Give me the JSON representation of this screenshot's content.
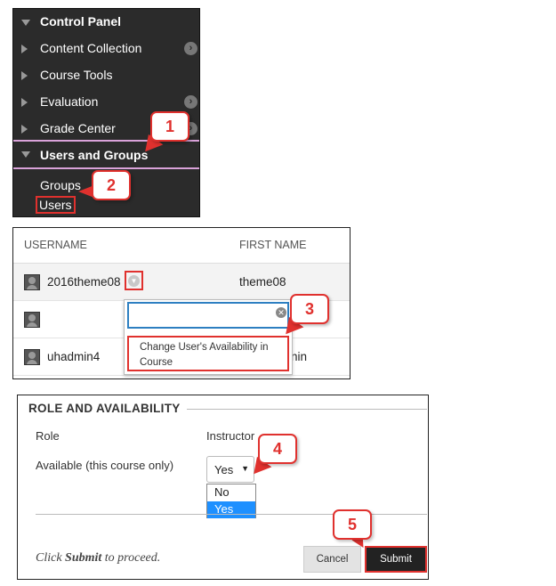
{
  "control_panel": {
    "title": "Control Panel",
    "items": [
      {
        "label": "Content Collection"
      },
      {
        "label": "Course Tools"
      },
      {
        "label": "Evaluation"
      },
      {
        "label": "Grade Center"
      },
      {
        "label": "Users and Groups"
      }
    ],
    "sub_items": [
      {
        "label": "Groups"
      },
      {
        "label": "Users"
      }
    ]
  },
  "users_list": {
    "columns": [
      "USERNAME",
      "FIRST NAME"
    ],
    "rows": [
      {
        "username": "2016theme08",
        "first_name": "theme08"
      },
      {
        "username": "",
        "first_name": ""
      },
      {
        "username": "uhadmin4",
        "first_name": "nin"
      }
    ],
    "dropdown": {
      "search_value": "",
      "option": "Change User's Availability in Course"
    }
  },
  "role_availability": {
    "title": "ROLE AND AVAILABILITY",
    "role_label": "Role",
    "role_value": "Instructor",
    "available_label": "Available (this course only)",
    "available_selected": "Yes",
    "available_options": [
      "No",
      "Yes"
    ],
    "hint_prefix": "Click ",
    "hint_bold": "Submit",
    "hint_suffix": " to proceed.",
    "cancel_label": "Cancel",
    "submit_label": "Submit"
  },
  "callouts": [
    "1",
    "2",
    "3",
    "4",
    "5"
  ],
  "colors": {
    "callout": "#e0312e",
    "panel_bg": "#2b2b2b",
    "highlight_option": "#1e90ff"
  }
}
